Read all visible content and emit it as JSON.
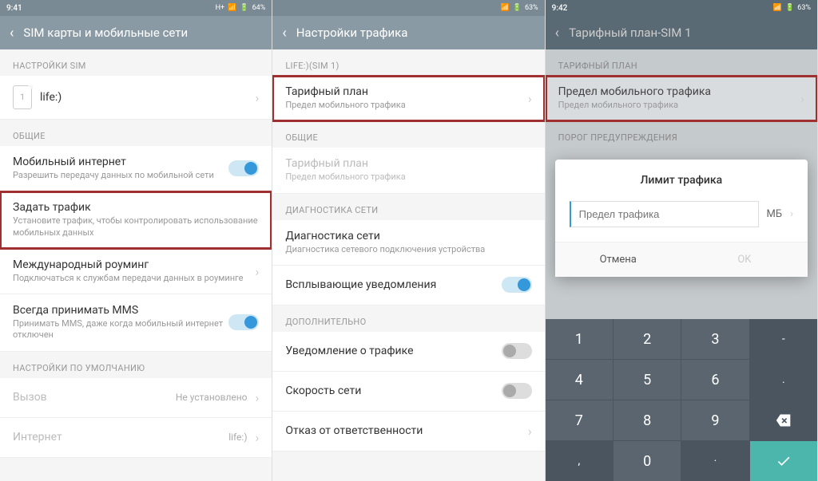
{
  "screen1": {
    "time": "9:41",
    "signal": "H+",
    "battery": "64%",
    "title": "SIM карты и мобильные сети",
    "sec_sim": "НАСТРОЙКИ SIM",
    "sim_name": "life:)",
    "sec_general": "ОБЩИЕ",
    "internet_title": "Мобильный интернет",
    "internet_sub": "Разрешить передачу данных по мобильной сети",
    "traffic_title": "Задать трафик",
    "traffic_sub": "Установите трафик, чтобы контролировать использование мобильных данных",
    "roaming_title": "Международный роуминг",
    "roaming_sub": "Подключаться к службам передачи данных в роуминге",
    "mms_title": "Всегда принимать MMS",
    "mms_sub": "Принимать MMS, даже когда мобильный интернет отключен",
    "sec_default": "НАСТРОЙКИ ПО УМОЛЧАНИЮ",
    "call_title": "Вызов",
    "call_val": "Не установлено",
    "net_title": "Интернет",
    "net_val": "life:)"
  },
  "screen2": {
    "time": "",
    "battery": "63%",
    "title": "Настройки трафика",
    "sec_life": "LIFE:)(SIM 1)",
    "tariff_title": "Тарифный план",
    "tariff_sub": "Предел мобильного трафика",
    "sec_general": "ОБЩИЕ",
    "tariff2_title": "Тарифный план",
    "tariff2_sub": "Предел мобильного трафика",
    "sec_diag": "ДИАГНОСТИКА СЕТИ",
    "diag_title": "Диагностика сети",
    "diag_sub": "Диагностика сетевого подключения устройства",
    "popup_title": "Всплывающие уведомления",
    "sec_extra": "ДОПОЛНИТЕЛЬНО",
    "notify_title": "Уведомление о трафике",
    "speed_title": "Скорость сети",
    "disclaim_title": "Отказ от ответственности"
  },
  "screen3": {
    "time": "9:42",
    "battery": "63%",
    "title": "Тарифный план-SIM 1",
    "sec_tariff": "ТАРИФНЫЙ ПЛАН",
    "limit_title": "Предел мобильного трафика",
    "limit_sub": "Предел мобильного трафика",
    "sec_warn": "ПОРОГ ПРЕДУПРЕЖДЕНИЯ",
    "dialog_title": "Лимит трафика",
    "placeholder": "Предел трафика",
    "unit": "МБ",
    "cancel": "Отмена",
    "ok": "OK",
    "keys": [
      "1",
      "2",
      "3",
      "-",
      "4",
      "5",
      "6",
      ".",
      "7",
      "8",
      "9",
      "⌫",
      ",",
      "0",
      "·",
      "✓"
    ]
  }
}
